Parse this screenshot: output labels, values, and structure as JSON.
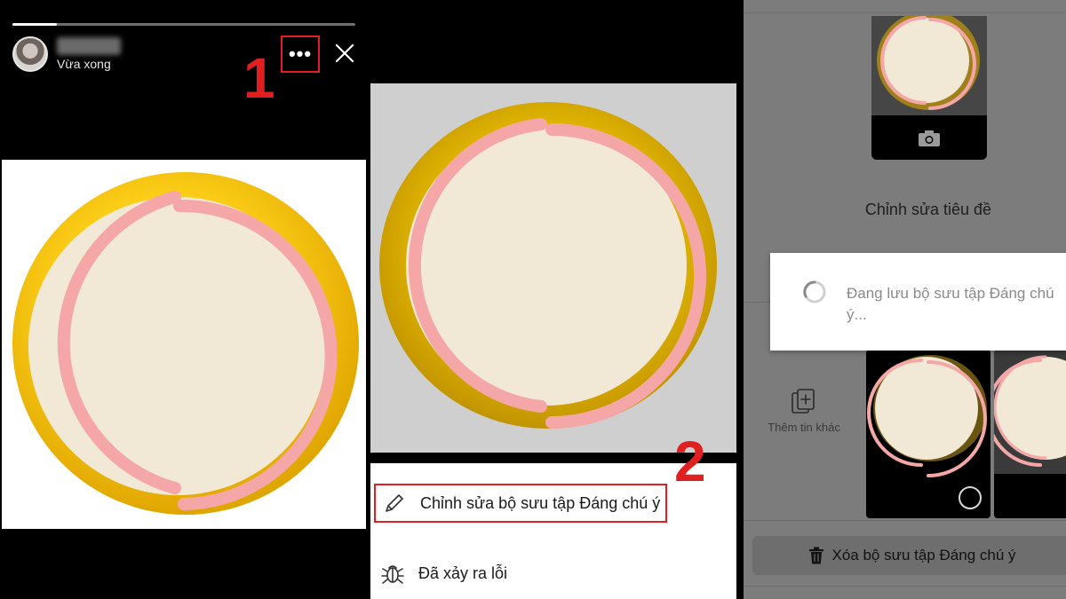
{
  "panel1": {
    "story_time": "Vừa xong",
    "more_label": "•••",
    "step_number": "1",
    "progress_fraction": 0.13
  },
  "panel2": {
    "step_number": "2",
    "menu_items": [
      {
        "label": "Chỉnh sửa bộ sưu tập Đáng chú ý",
        "icon": "pencil-icon"
      },
      {
        "label": "Đã xảy ra lỗi",
        "icon": "bug-icon"
      }
    ]
  },
  "panel3": {
    "edit_title": "Chỉnh sửa tiêu đề",
    "add_story_label": "Thêm tin khác",
    "saving_message": "Đang lưu bộ sưu tập Đáng chú ý...",
    "delete_label": "Xóa bộ sưu tập Đáng chú ý"
  },
  "colors": {
    "highlight_red": "#e02020",
    "ring_gold": "#f2c200",
    "ring_pink": "#f5a7a7",
    "ring_fill": "#f1e8d6"
  }
}
